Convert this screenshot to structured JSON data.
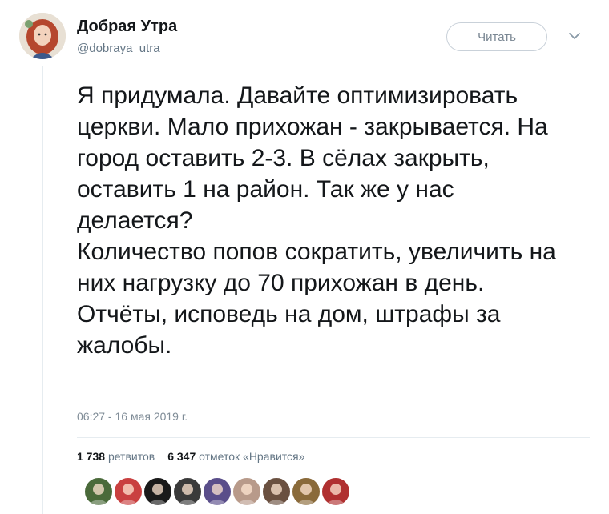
{
  "account": {
    "display_name": "Добрая Утра",
    "handle": "@dobraya_utra",
    "follow_label": "Читать"
  },
  "tweet": {
    "paragraph1": "Я придумала. Давайте оптимизировать церкви. Мало прихожан - закрывается. На город оставить 2-3. В сёлах закрыть, оставить 1 на район. Так же у нас делается?",
    "paragraph2": "Количество попов сократить, увеличить на них нагрузку до 70 прихожан в день. Отчёты, исповедь на дом, штрафы за жалобы.",
    "timestamp": "06:27 - 16 мая 2019 г."
  },
  "stats": {
    "retweets_count": "1 738",
    "retweets_label": "ретвитов",
    "likes_count": "6 347",
    "likes_label": "отметок «Нравится»"
  },
  "likers": [
    {
      "icon": "liker-avatar-1",
      "color": "#4a6a3a"
    },
    {
      "icon": "liker-avatar-2",
      "color": "#c94040"
    },
    {
      "icon": "liker-avatar-3",
      "color": "#1a1a1a"
    },
    {
      "icon": "liker-avatar-4",
      "color": "#3a3a3a"
    },
    {
      "icon": "liker-avatar-5",
      "color": "#5a4e8a"
    },
    {
      "icon": "liker-avatar-6",
      "color": "#b89a8a"
    },
    {
      "icon": "liker-avatar-7",
      "color": "#6a5040"
    },
    {
      "icon": "liker-avatar-8",
      "color": "#8a6a3a"
    },
    {
      "icon": "liker-avatar-9",
      "color": "#b03030"
    }
  ]
}
